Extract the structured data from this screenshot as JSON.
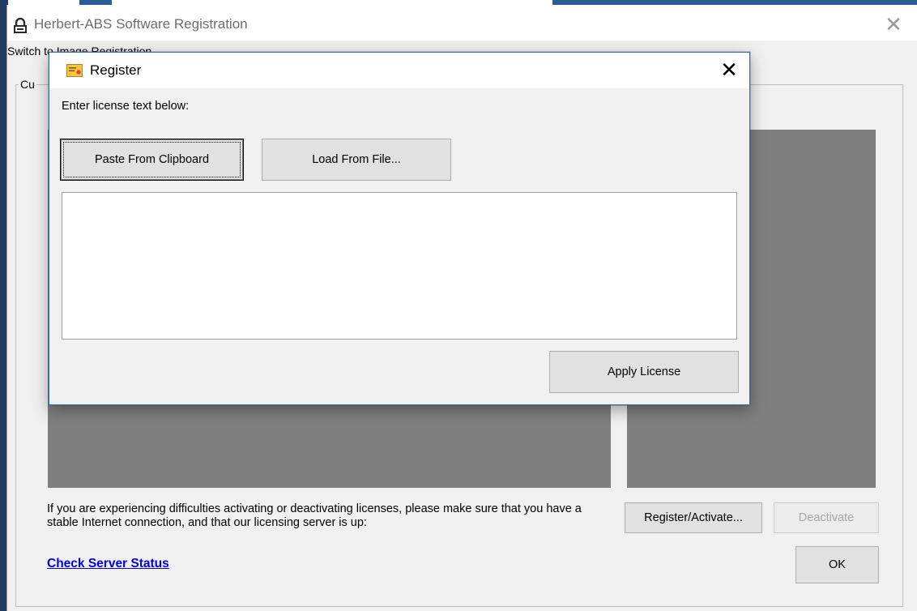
{
  "main_window": {
    "title": "Herbert-ABS Software Registration",
    "menu": {
      "items": [
        "Switch to Image Registration"
      ]
    },
    "group_label": "Cu",
    "note_text": "If you are experiencing difficulties activating or deactivating licenses, please make sure that you have a stable Internet connection, and that our licensing server is up:",
    "check_server_status_label": "Check Server Status",
    "register_activate_label": "Register/Activate...",
    "deactivate_label": "Deactivate",
    "ok_label": "OK",
    "close_glyph": "✕"
  },
  "dialog": {
    "title": "Register",
    "close_glyph": "✕",
    "prompt": "Enter license text below:",
    "paste_label": "Paste From Clipboard",
    "load_label": "Load From File...",
    "license_text": "",
    "apply_label": "Apply License"
  },
  "colors": {
    "panel_gray": "#7f7f7f",
    "link_blue": "#0000ee",
    "dialog_border": "#3a6ea5"
  },
  "icons": {
    "app": "lock-icon",
    "dialog": "certificate-icon"
  }
}
